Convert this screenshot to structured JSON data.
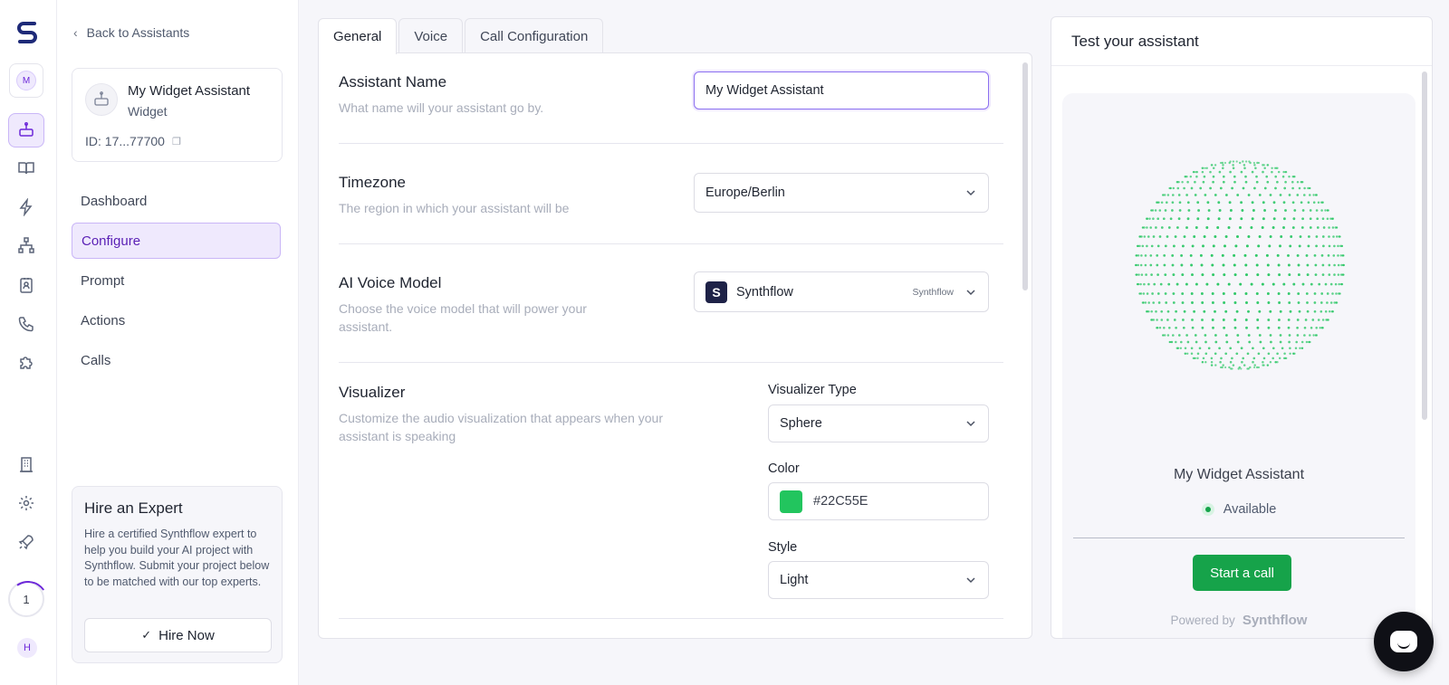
{
  "rail": {
    "avatar_initial": "M",
    "step_number": "1",
    "user_initial": "H",
    "icons": [
      "assistant-icon",
      "book-icon",
      "lightning-icon",
      "network-icon",
      "contact-card-icon",
      "phone-icon",
      "puzzle-icon",
      "building-icon",
      "gear-icon",
      "rocket-icon"
    ]
  },
  "sidebar": {
    "back_label": "Back to Assistants",
    "assistant": {
      "name": "My Widget Assistant",
      "type": "Widget",
      "id": "ID: 17...77700"
    },
    "nav": [
      {
        "label": "Dashboard",
        "active": false
      },
      {
        "label": "Configure",
        "active": true
      },
      {
        "label": "Prompt",
        "active": false
      },
      {
        "label": "Actions",
        "active": false
      },
      {
        "label": "Calls",
        "active": false
      }
    ],
    "hire": {
      "title": "Hire an Expert",
      "text": "Hire a certified Synthflow expert to help you build your AI project with Synthflow. Submit your project below to be matched with our top experts.",
      "button": "Hire Now"
    }
  },
  "tabs": [
    {
      "label": "General",
      "active": true
    },
    {
      "label": "Voice",
      "active": false
    },
    {
      "label": "Call Configuration",
      "active": false
    }
  ],
  "form": {
    "name": {
      "title": "Assistant Name",
      "description": "What name will your assistant go by.",
      "value": "My Widget Assistant"
    },
    "timezone": {
      "title": "Timezone",
      "description": "The region in which your assistant will be",
      "value": "Europe/Berlin"
    },
    "voice_model": {
      "title": "AI Voice Model",
      "description": "Choose the voice model that will power your assistant.",
      "value": "Synthflow",
      "tag": "Synthflow",
      "logo_letter": "S"
    },
    "visualizer": {
      "title": "Visualizer",
      "description": "Customize the audio visualization that appears when your assistant is speaking",
      "type_label": "Visualizer Type",
      "type_value": "Sphere",
      "color_label": "Color",
      "color_value": "#22C55E",
      "style_label": "Style",
      "style_value": "Light"
    }
  },
  "test_panel": {
    "title": "Test your assistant",
    "assistant_name": "My Widget Assistant",
    "status": "Available",
    "start_button": "Start a call",
    "powered_by": "Powered by",
    "brand": "Synthflow",
    "sphere_color": "#22C55E"
  },
  "colors": {
    "accent": "#6d28d9",
    "success": "#16a34a"
  }
}
